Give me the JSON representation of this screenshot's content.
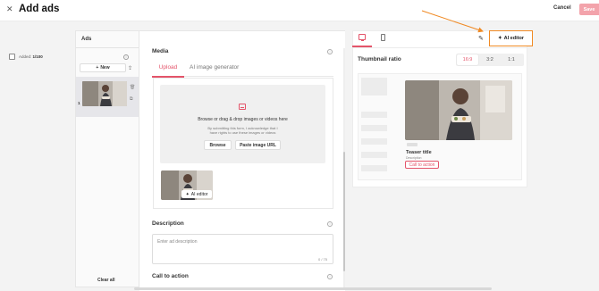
{
  "header": {
    "close_icon": "close-icon",
    "title": "Add ads",
    "cancel_label": "Cancel",
    "save_label": "Save"
  },
  "ads_panel": {
    "title": "Ads",
    "added_prefix": "Added: ",
    "added_count": "1/100",
    "new_label": "New",
    "items": [
      {
        "number": "1"
      }
    ],
    "clear_all_label": "Clear all"
  },
  "media": {
    "title": "Media",
    "tabs": [
      {
        "label": "Upload",
        "active": true
      },
      {
        "label": "AI image generator",
        "active": false
      }
    ],
    "dropzone_text": "Browse or drag & drop images or videos here",
    "dropzone_note_line1": "By submitting this form, I acknowledge that I",
    "dropzone_note_line2": "have rights to use these images or videos",
    "browse_label": "Browse",
    "paste_url_label": "Paste image URL",
    "ai_editor_chip_label": "AI editor"
  },
  "description": {
    "title": "Description",
    "placeholder": "Enter ad description",
    "counter": "0 / 75"
  },
  "call_to_action": {
    "title": "Call to action"
  },
  "preview": {
    "ai_editor_label": "AI editor",
    "thumbnail_ratio_label": "Thumbnail ratio",
    "ratios": [
      {
        "label": "16:9",
        "active": true
      },
      {
        "label": "3:2",
        "active": false
      },
      {
        "label": "1:1",
        "active": false
      }
    ],
    "teaser_title": "Teaser title",
    "teaser_description": "Description",
    "cta_label": "Call to action"
  },
  "colors": {
    "accent": "#e4546a",
    "highlight": "#f08a24",
    "save_disabled": "#f3a3ab"
  }
}
